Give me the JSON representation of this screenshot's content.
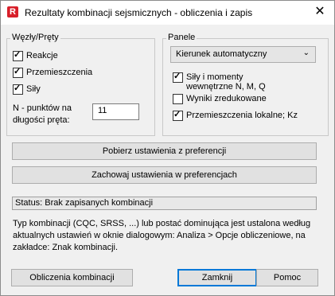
{
  "window": {
    "title": "Rezultaty kombinacji sejsmicznych - obliczenia i zapis",
    "app_icon": "R",
    "close_glyph": "✕"
  },
  "nodes_group": {
    "legend": "Węzły/Pręty",
    "checkboxes": [
      {
        "label": "Reakcje",
        "checked": true
      },
      {
        "label": "Przemieszczenia",
        "checked": true
      },
      {
        "label": "Siły",
        "checked": true
      }
    ],
    "points_label": "N - punktów na długości pręta:",
    "points_value": "11"
  },
  "panels_group": {
    "legend": "Panele",
    "direction_select": "Kierunek automatyczny",
    "checkboxes": [
      {
        "label": "Siły i momenty wewnętrzne N, M, Q",
        "checked": true
      },
      {
        "label": "Wyniki zredukowane",
        "checked": false
      },
      {
        "label": "Przemieszczenia lokalne; Kz",
        "checked": true
      }
    ]
  },
  "buttons": {
    "load_prefs": "Pobierz ustawienia z preferencji",
    "save_prefs": "Zachowaj ustawienia w preferencjach",
    "compute": "Obliczenia kombinacji",
    "close": "Zamknij",
    "help": "Pomoc"
  },
  "status": "Status: Brak zapisanych kombinacji",
  "note": "Typ kombinacji (CQC, SRSS, ...) lub postać dominująca jest ustalona według aktualnych ustawień w oknie dialogowym: Analiza > Opcje obliczeniowe, na zakładce: Znak kombinacji."
}
